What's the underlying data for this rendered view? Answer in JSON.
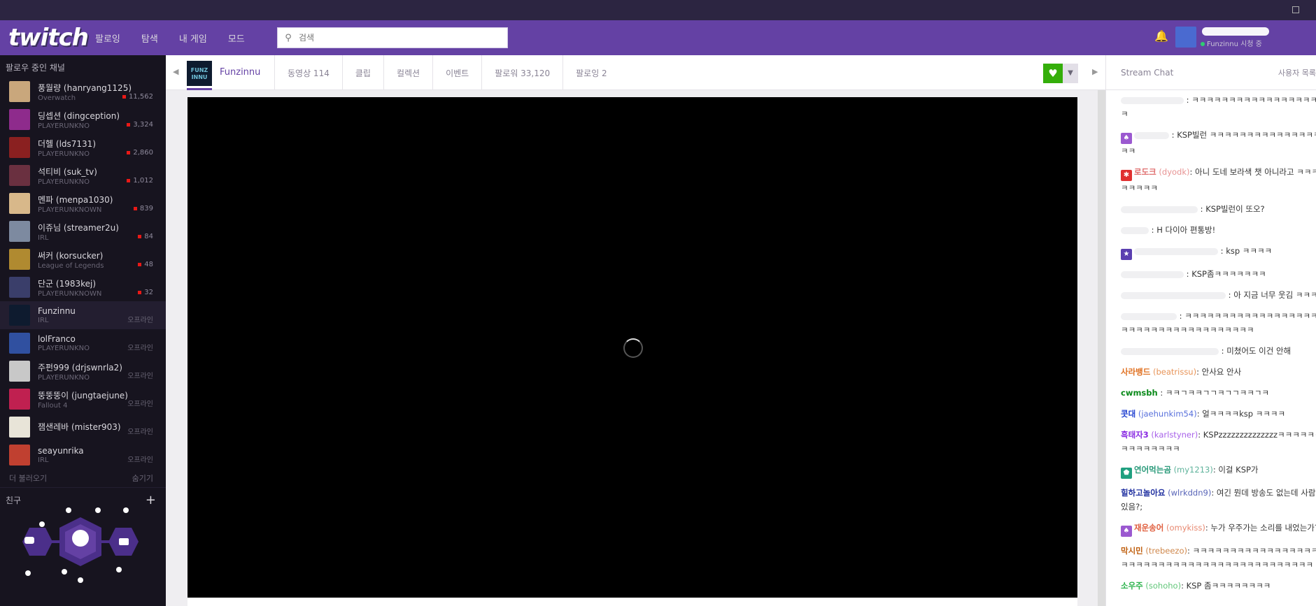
{
  "colors": {
    "brand": "#6441a4",
    "sidebar": "#17141f",
    "live": "#e91916",
    "follow": "#34ae0a"
  },
  "topnav": {
    "logo": "twitch",
    "links": [
      "팔로잉",
      "탐색",
      "내 게임",
      "모드"
    ],
    "search_placeholder": "검색",
    "user_status": "Funzinnu 시청 중"
  },
  "sidebar": {
    "header": "팔로우 중인 채널",
    "channels": [
      {
        "name": "풍월량 (hanryang1125)",
        "game": "Overwatch",
        "viewers": "11,562",
        "live": true,
        "color": "#c9a77c"
      },
      {
        "name": "딩셉션 (dingception)",
        "game": "PLAYERUNKNO",
        "viewers": "3,324",
        "live": true,
        "color": "#8e2b8c"
      },
      {
        "name": "더헬 (lds7131)",
        "game": "PLAYERUNKNO",
        "viewers": "2,860",
        "live": true,
        "color": "#8a2020"
      },
      {
        "name": "석티비 (suk_tv)",
        "game": "PLAYERUNKNO",
        "viewers": "1,012",
        "live": true,
        "color": "#6a3040"
      },
      {
        "name": "멘파 (menpa1030)",
        "game": "PLAYERUNKNOWN",
        "viewers": "839",
        "live": true,
        "color": "#d8b88a"
      },
      {
        "name": "이쥬님 (streamer2u)",
        "game": "IRL",
        "viewers": "84",
        "live": true,
        "color": "#7d8aa0"
      },
      {
        "name": "써커 (korsucker)",
        "game": "League of Legends",
        "viewers": "48",
        "live": true,
        "color": "#b08a30"
      },
      {
        "name": "단군 (1983kej)",
        "game": "PLAYERUNKNOWN",
        "viewers": "32",
        "live": true,
        "color": "#3a3e6a"
      },
      {
        "name": "Funzinnu",
        "game": "IRL",
        "viewers": "오프라인",
        "live": false,
        "active": true,
        "color": "#0e1b2f"
      },
      {
        "name": "lolFranco",
        "game": "PLAYERUNKNO",
        "viewers": "오프라인",
        "live": false,
        "color": "#3050a0"
      },
      {
        "name": "주펀999 (drjswnrla2)",
        "game": "PLAYERUNKNO",
        "viewers": "오프라인",
        "live": false,
        "color": "#c8c8c8"
      },
      {
        "name": "뚱뚱뚱이 (jungtaejune)",
        "game": "Fallout 4",
        "viewers": "오프라인",
        "live": false,
        "color": "#c02050"
      },
      {
        "name": "잼샌레바 (mister903)",
        "game": "",
        "viewers": "오프라인",
        "live": false,
        "color": "#e8e4d8"
      },
      {
        "name": "seayunrika",
        "game": "IRL",
        "viewers": "오프라인",
        "live": false,
        "color": "#c04030"
      }
    ],
    "more": "더 불러오기",
    "hide": "숨기기",
    "friends": "친구",
    "friends_add": "+"
  },
  "channel": {
    "name": "Funzinnu",
    "logo_text": "FUNZ INNU",
    "tabs": [
      "동영상 114",
      "클립",
      "컬렉션",
      "이벤트",
      "팔로워 33,120",
      "팔로잉 2"
    ]
  },
  "chat": {
    "title": "Stream Chat",
    "users": "사용자 목록",
    "messages": [
      {
        "user": "",
        "login": "",
        "text": "ㅋㅋㅋㅋㅋㅋㅋㅋㅋㅋㅋㅋㅋㅋㅋㅋㅋㅋㅋ",
        "ucolor": "#2bb34c",
        "badge": "",
        "blur": 90
      },
      {
        "user": "",
        "login": "",
        "text": "KSP빌런 ㅋㅋㅋㅋㅋㅋㅋㅋㅋㅋㅋㅋㅋㅋㅋㅋㅋㅋ",
        "ucolor": "#3a3ed0",
        "badge": "spade",
        "blur": 50
      },
      {
        "user": "로도크",
        "login": "(dyodk)",
        "text": "아니 도네 보라색 챗 아니라고 ㅋㅋㅋㅋㅋㅋㅋㅋㅋ",
        "ucolor": "#e07070",
        "badge": "gear",
        "blur": 0
      },
      {
        "user": "",
        "login": "",
        "text": "KSP빌런이 또오?",
        "ucolor": "#333",
        "badge": "",
        "blur": 110
      },
      {
        "user": "",
        "login": "",
        "text": "H 다이아 편통방!",
        "ucolor": "#333",
        "badge": "",
        "blur": 40
      },
      {
        "user": "",
        "login": "",
        "text": "ksp ㅋㅋㅋㅋ",
        "ucolor": "#e05060",
        "badge": "star",
        "blur": 120
      },
      {
        "user": "",
        "login": "",
        "text": "KSP좀ㅋㅋㅋㅋㅋㅋㅋ",
        "ucolor": "#333",
        "badge": "",
        "blur": 90
      },
      {
        "user": "",
        "login": "",
        "text": "아 지금 너무 웃김 ㅋㅋㅋㅋ",
        "ucolor": "#e07040",
        "badge": "",
        "blur": 150
      },
      {
        "user": "",
        "login": "",
        "text": "ㅋㅋㅋㅋㅋㅋㅋㅋㅋㅋㅋㅋㅋㅋㅋㅋㅋㅋㅋㅋㅋㅋㅋㅋㅋㅋㅋㅋㅋㅋㅋㅋㅋㅋㅋㅋㅋ",
        "ucolor": "#333",
        "badge": "",
        "blur": 80
      },
      {
        "user": "",
        "login": "",
        "text": "미쳤어도 이건 안해",
        "ucolor": "#e07070",
        "badge": "",
        "blur": 140
      },
      {
        "user": "사라뱅드",
        "login": "(beatrissu)",
        "text": "안사요 안사",
        "ucolor": "#e07020",
        "badge": "",
        "blur": 0
      },
      {
        "user": "cwmsbh",
        "login": "",
        "text": "ㅋㅋㄱㅋㅋㄱㄱㅋㄱㄱㅋㅋㄱㅋ",
        "ucolor": "#0a8a1a",
        "badge": "",
        "blur": 0
      },
      {
        "user": "콧대",
        "login": "(jaehunkim54)",
        "text": "얼ㅋㅋㅋㅋksp ㅋㅋㅋㅋ",
        "ucolor": "#2040d0",
        "badge": "",
        "blur": 0
      },
      {
        "user": "흑태자3",
        "login": "(karlstyner)",
        "text": "KSPzzzzzzzzzzzzzzㅋㅋㅋㅋㅋㅋㅋㅋㅋㅋㅋㅋㅋㅋㅋ",
        "ucolor": "#8a2be2",
        "badge": "",
        "blur": 0
      },
      {
        "user": "연어먹는곰",
        "login": "(my1213)",
        "text": "이걸 KSP가",
        "ucolor": "#2a9a7a",
        "badge": "pentagon",
        "blur": 0
      },
      {
        "user": "힐하고놀아요",
        "login": "(wlrkddn9)",
        "text": "여긴 뭔데 방송도 없는데 사람이 있음?;",
        "ucolor": "#2030a0",
        "badge": "",
        "blur": 0
      },
      {
        "user": "재운송어",
        "login": "(omykiss)",
        "text": "누가 우주가는 소리를 내었는가??",
        "ucolor": "#e06040",
        "badge": "spade",
        "blur": 0
      },
      {
        "user": "막시민",
        "login": "(trebeezo)",
        "text": "ㅋㅋㅋㅋㅋㅋㅋㅋㅋㅋㅋㅋㅋㅋㅋㅋㅋㅋㅋㅋㅋㅋㅋㅋㅋㅋㅋㅋㅋㅋㅋㅋㅋㅋㅋㅋㅋㅋㅋㅋㅋㅋㅋㅋ",
        "ucolor": "#c06010",
        "badge": "",
        "blur": 0
      },
      {
        "user": "소우주",
        "login": "(sohoho)",
        "text": "KSP 좀ㅋㅋㅋㅋㅋㅋㅋㅋ",
        "ucolor": "#2bb34c",
        "badge": "",
        "blur": 0
      }
    ]
  }
}
